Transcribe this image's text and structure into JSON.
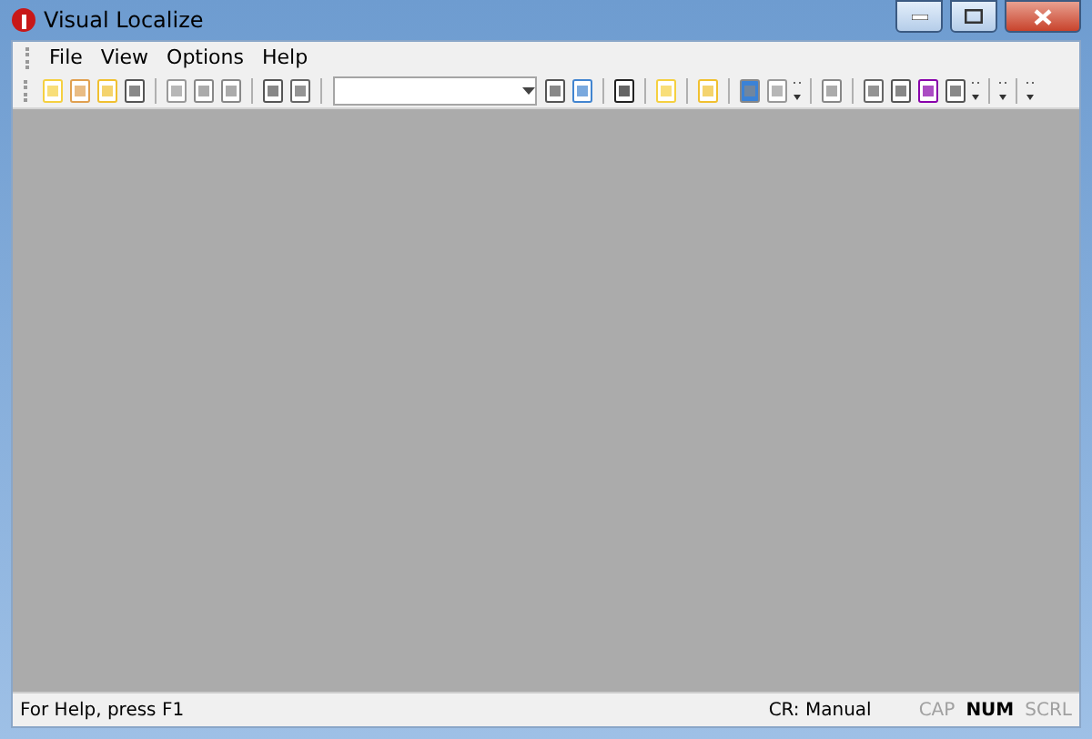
{
  "window": {
    "title": "Visual Localize"
  },
  "menu": [
    {
      "label": "File"
    },
    {
      "label": "View"
    },
    {
      "label": "Options"
    },
    {
      "label": "Help"
    }
  ],
  "status_bar": {
    "message": "For Help, press F1",
    "cr_mode": "CR: Manual",
    "indicators": [
      {
        "label": "CAP",
        "active": false
      },
      {
        "label": "NUM",
        "active": true
      },
      {
        "label": "SCRL",
        "active": false
      }
    ]
  }
}
